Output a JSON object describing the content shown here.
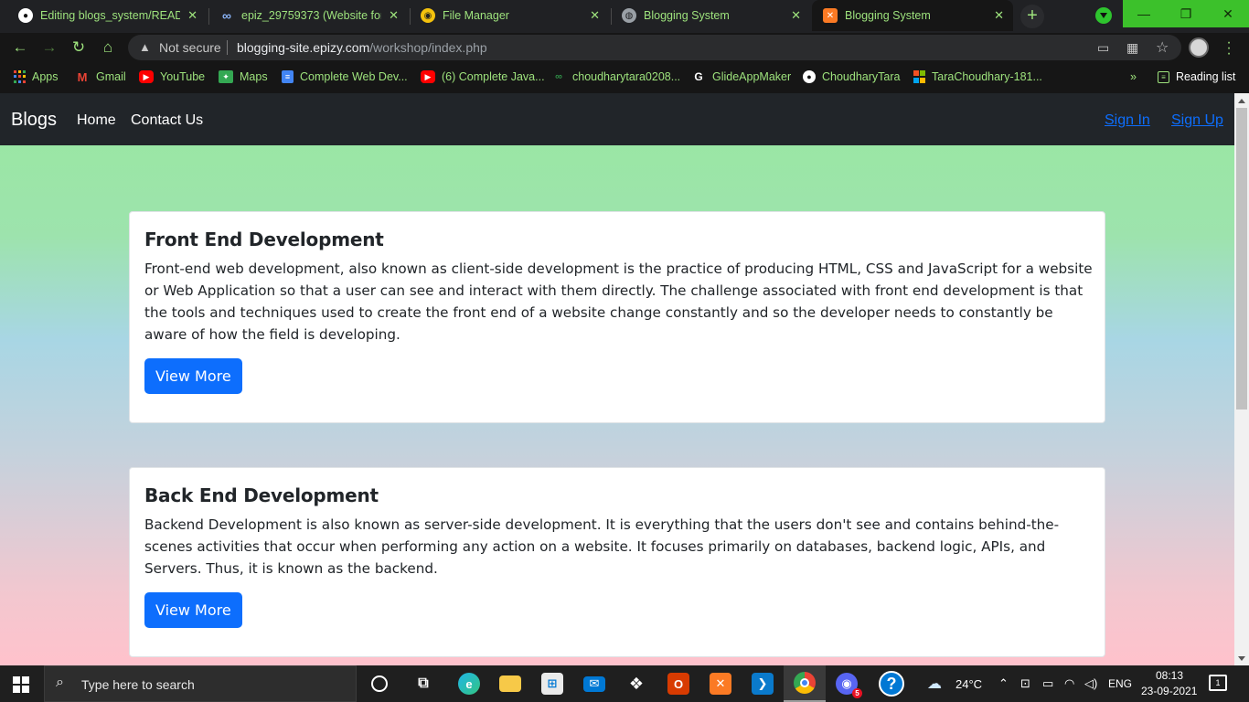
{
  "browser": {
    "tabs": [
      {
        "title": "Editing blogs_system/READM",
        "icon": "github-icon"
      },
      {
        "title": "epiz_29759373 (Website for b",
        "icon": "infinity-icon"
      },
      {
        "title": "File Manager",
        "icon": "file-manager-icon"
      },
      {
        "title": "Blogging System",
        "icon": "globe-icon"
      },
      {
        "title": "Blogging System",
        "icon": "xampp-icon",
        "active": true
      }
    ],
    "new_tab_label": "+",
    "address": {
      "security_label": "Not secure",
      "host": "blogging-site.epizy.com",
      "path": "/workshop/index.php"
    },
    "bookmarks": [
      {
        "label": "Apps",
        "icon": "apps-grid-icon",
        "color": "#ea4335"
      },
      {
        "label": "Gmail",
        "icon": "gmail-icon",
        "color": "#ea4335"
      },
      {
        "label": "YouTube",
        "icon": "youtube-icon",
        "color": "#ff0000"
      },
      {
        "label": "Maps",
        "icon": "maps-icon",
        "color": "#34a853"
      },
      {
        "label": "Complete Web Dev...",
        "icon": "docs-icon",
        "color": "#4285f4"
      },
      {
        "label": "(6) Complete Java...",
        "icon": "youtube-icon",
        "color": "#ff0000"
      },
      {
        "label": "choudharytara0208...",
        "icon": "gfg-icon",
        "color": "#2f8d46"
      },
      {
        "label": "GlideAppMaker",
        "icon": "glide-icon",
        "color": "#ffffff"
      },
      {
        "label": "ChoudharyTara",
        "icon": "github-icon",
        "color": "#ffffff"
      },
      {
        "label": "TaraChoudhary-181...",
        "icon": "microsoft-icon",
        "color": "#f25022"
      }
    ],
    "more_bookmarks": "»",
    "reading_list": "Reading list"
  },
  "site": {
    "brand": "Blogs",
    "nav": [
      "Home",
      "Contact Us"
    ],
    "auth": {
      "sign_in": "Sign In",
      "sign_up": "Sign Up"
    },
    "cards": [
      {
        "title": "Front End Development",
        "body": "Front-end web development, also known as client-side development is the practice of producing HTML, CSS and JavaScript for a website or Web Application so that a user can see and interact with them directly. The challenge associated with front end development is that the tools and techniques used to create the front end of a website change constantly and so the developer needs to constantly be aware of how the field is developing.",
        "button": "View More"
      },
      {
        "title": "Back End Development",
        "body": "Backend Development is also known as server-side development. It is everything that the users don't see and contains behind-the-scenes activities that occur when performing any action on a website. It focuses primarily on databases, backend logic, APIs, and Servers. Thus, it is known as the backend.",
        "button": "View More"
      }
    ]
  },
  "taskbar": {
    "search_placeholder": "Type here to search",
    "weather": "24°C",
    "language": "ENG",
    "time": "08:13",
    "date": "23-09-2021",
    "notification_count": "1",
    "discord_badge": "5"
  },
  "colors": {
    "browser_accent": "#9ee37d",
    "primary_button": "#0d6efd",
    "navbar_bg": "#212529"
  }
}
